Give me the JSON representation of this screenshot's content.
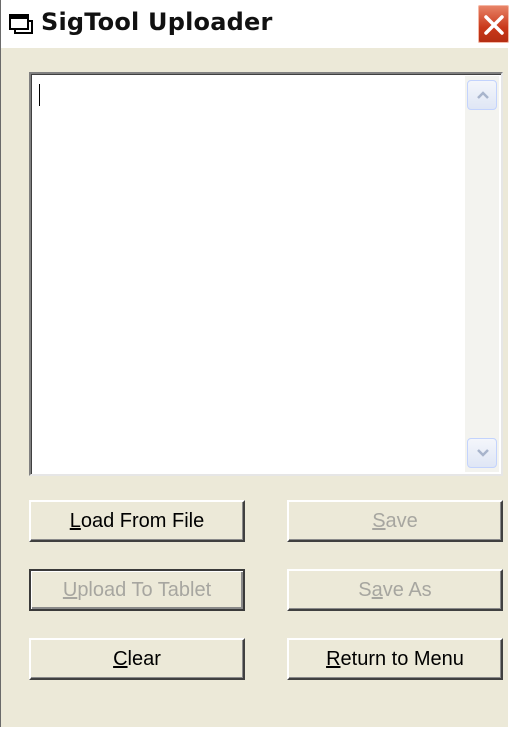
{
  "window": {
    "title": "SigTool Uploader",
    "icon": "app-window-icon",
    "close_icon": "close-icon"
  },
  "editor": {
    "value": ""
  },
  "buttons": {
    "load_from_file": {
      "accel": "L",
      "rest": "oad From File",
      "enabled": true
    },
    "save": {
      "accel": "S",
      "rest": "ave",
      "enabled": false
    },
    "upload_to_tablet": {
      "accel": "U",
      "rest": "pload To Tablet",
      "enabled": false
    },
    "save_as": {
      "pre": "S",
      "accel": "a",
      "rest": "ve As",
      "enabled": false
    },
    "clear": {
      "accel": "C",
      "rest": "lear",
      "enabled": true
    },
    "return_to_menu": {
      "accel": "R",
      "rest": "eturn to Menu",
      "enabled": true
    }
  },
  "colors": {
    "face": "#ece9d8",
    "close_red": "#c9381a",
    "disabled_text": "#a7a6a0"
  }
}
